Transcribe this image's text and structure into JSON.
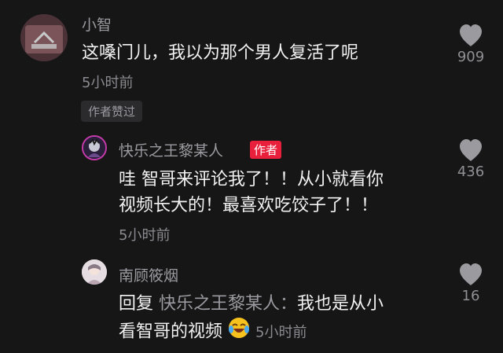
{
  "comments": [
    {
      "username": "小智",
      "text": "这嗓门儿，我以为那个男人复活了呢",
      "time": "5小时前",
      "author_liked_label": "作者赞过",
      "likes": "909"
    },
    {
      "username": "快乐之王黎某人",
      "author_badge": "作者",
      "text_line1": "哇 智哥来评论我了！！从小就看你",
      "text_line2": "视频长大的！最喜欢吃饺子了！！",
      "time": "5小时前",
      "likes": "436"
    },
    {
      "username": "南顾筱烟",
      "reply_prefix": "回复",
      "reply_target": "快乐之王黎某人：",
      "text_line1_rest": "我也是从小",
      "text_line2": "看智哥的视频",
      "emoji_icon": "laughing-crying-emoji-icon",
      "time": "5小时前",
      "likes": "16"
    }
  ],
  "colors": {
    "background": "#161616",
    "author_badge": "#e8203c",
    "heart": "#9a9a9f"
  }
}
